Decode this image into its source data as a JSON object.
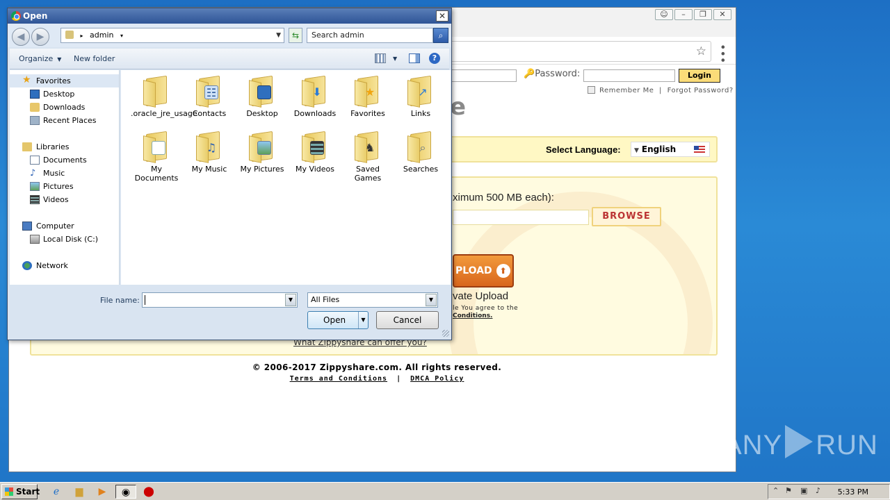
{
  "browser": {
    "password_label": "Password:",
    "login_label": "Login",
    "remember_label": "Remember Me",
    "forgot_label": "Forgot Password?",
    "logo_fragment": "e",
    "select_language_label": "Select Language:",
    "language_value": "English",
    "max_text": "ximum 500 MB each):",
    "browse_label": "BROWSE",
    "upload_label": "PLOAD",
    "private_label": "vate Upload",
    "agree_text": "le You agree to the",
    "conditions_text": "Conditions.",
    "whatzip_text": "What Zippyshare can offer you?",
    "copyright": "© 2006-2017 Zippyshare.com. All rights reserved.",
    "terms_label": "Terms and Conditions",
    "separator": "|",
    "dmca_label": "DMCA Policy"
  },
  "dialog": {
    "title": "Open",
    "address": "admin",
    "search_placeholder": "Search admin",
    "organize_label": "Organize",
    "new_folder_label": "New folder",
    "nav": {
      "favorites": "Favorites",
      "desktop": "Desktop",
      "downloads": "Downloads",
      "recent_places": "Recent Places",
      "libraries": "Libraries",
      "documents": "Documents",
      "music": "Music",
      "pictures": "Pictures",
      "videos": "Videos",
      "computer": "Computer",
      "local_disk": "Local Disk (C:)",
      "network": "Network"
    },
    "files": [
      ".oracle_jre_usage",
      "Contacts",
      "Desktop",
      "Downloads",
      "Favorites",
      "Links",
      "My Documents",
      "My Music",
      "My Pictures",
      "My Videos",
      "Saved Games",
      "Searches"
    ],
    "file_name_label": "File name:",
    "file_name_value": "",
    "file_type_value": "All Files",
    "open_label": "Open",
    "cancel_label": "Cancel"
  },
  "taskbar": {
    "start_label": "Start",
    "clock": "5:33 PM"
  },
  "watermark": {
    "left": "ANY",
    "right": "RUN"
  },
  "icons": {
    "favorites": "star-icon",
    "music": "music-note-icon",
    "search": "magnifier-icon",
    "help": "help-icon"
  }
}
